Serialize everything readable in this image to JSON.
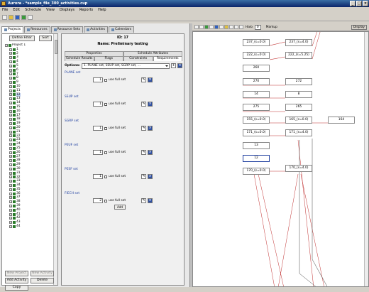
{
  "window": {
    "title": "Aurora - *sample_file_300_activities.cup",
    "buttons": [
      "_",
      "□",
      "×"
    ]
  },
  "menu": [
    "File",
    "Edit",
    "Schedule",
    "View",
    "Displays",
    "Reports",
    "Help"
  ],
  "left_tabs": [
    "Projects",
    "Resources",
    "Resource Sets",
    "Activities",
    "Calendars"
  ],
  "tree": {
    "filter_label": "Define Filter",
    "sort_label": "Sort",
    "project": "Project 1",
    "items": [
      "1",
      "2",
      "3",
      "4",
      "5",
      "6",
      "7",
      "8",
      "9",
      "10",
      "11",
      "12",
      "13",
      "14",
      "15",
      "16",
      "17",
      "18",
      "19",
      "20",
      "21",
      "22",
      "23",
      "24",
      "25",
      "26",
      "27",
      "28",
      "29",
      "30",
      "31",
      "32",
      "33",
      "34",
      "35",
      "36",
      "37",
      "38",
      "39",
      "40",
      "41",
      "42",
      "43",
      "44"
    ],
    "selected": "12",
    "buttons": [
      "New Project",
      "New Activity",
      "Add Activity",
      "Delete",
      "Copy"
    ]
  },
  "detail": {
    "id_line": "ID: 17",
    "name_line": "Name: Preliminary testing",
    "tabs_row1": [
      "Properties",
      "Schedule Attributes"
    ],
    "tabs_row2": [
      "Schedule Results",
      "Flags",
      "Constraints",
      "Requirements"
    ],
    "options_label": "Options:",
    "options_value": "1. PLANE set, SSUP set, SGRP set, ...",
    "sets": [
      {
        "label": "PLANE set",
        "value": "1",
        "checkbox": "use full set"
      },
      {
        "label": "SSUP set",
        "value": "1",
        "checkbox": "use full set"
      },
      {
        "label": "SGRP set",
        "value": "1",
        "checkbox": "use full set"
      },
      {
        "label": "PEUF set",
        "value": "1",
        "checkbox": "use full set"
      },
      {
        "label": "PESF set",
        "value": "1",
        "checkbox": "use full set"
      },
      {
        "label": "FIECH set",
        "value": "2",
        "checkbox": "use full set"
      }
    ],
    "add_label": "Add"
  },
  "right_toolbar": {
    "halo_label": "Halo",
    "halo_value": "0",
    "markup_label": "Markup",
    "display_label": "Display"
  },
  "graph_nodes": [
    "237_(s=0.0)",
    "237_(s=4.0)",
    "222_(s=0.0)",
    "222_(s=5.25)",
    "260",
    "270",
    "272",
    "14",
    "8",
    "275",
    "265",
    "155_(s=0.0)",
    "165_(s=0.0)",
    "164",
    "171_(s=0.0)",
    "171_(s=4.0)",
    "13",
    "12",
    "170_(s=0.0)",
    "170_(s=4.0)"
  ]
}
